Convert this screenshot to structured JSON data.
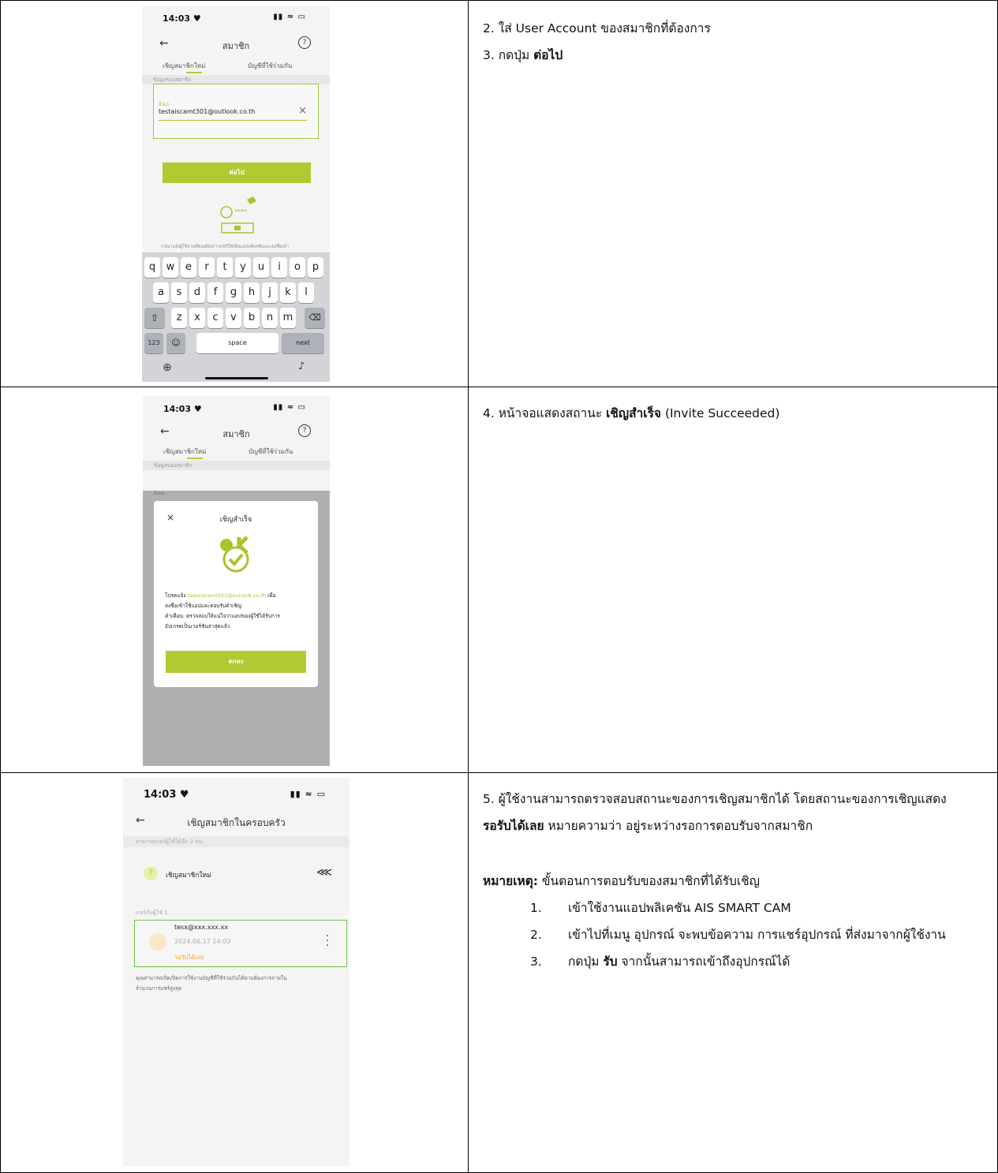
{
  "phone1": {
    "time": "14:03 ♥",
    "title": "สมาชิก",
    "tab_new": "เชิญสมาชิกใหม่",
    "tab_shared": "บัญชีที่ใช้ร่วมกัน",
    "section": "ข้อมูลของสมาชิก",
    "field_label": "อีเมล",
    "field_value": "testaiscamt301@outlook.co.th",
    "next_button": "ต่อไป",
    "hint": "กรุณาแจ้งผู้ใช้งานที่คุณต้องการแชร์ให้เปิดแอปพลิเคชันและลงชื่อเข้า",
    "keyboard_rows": [
      [
        "q",
        "w",
        "e",
        "r",
        "t",
        "y",
        "u",
        "i",
        "o",
        "p"
      ],
      [
        "a",
        "s",
        "d",
        "f",
        "g",
        "h",
        "j",
        "k",
        "l"
      ],
      [
        "z",
        "x",
        "c",
        "v",
        "b",
        "n",
        "m"
      ]
    ],
    "key_123": "123",
    "key_space": "space",
    "key_next": "next"
  },
  "phone2": {
    "time": "14:03 ♥",
    "title": "สมาชิก",
    "tab_new": "เชิญสมาชิกใหม่",
    "tab_shared": "บัญชีที่ใช้ร่วมกัน",
    "section": "ข้อมูลของสมาชิก",
    "field_label": "อีเมล",
    "modal_title": "เชิญสำเร็จ",
    "msg_prefix": "โปรดแจ้ง ",
    "msg_email": "testaiscamt301@outlook.co.th",
    "msg_suffix": " เพื่อ",
    "msg_line2": "ลงชื่อเข้าใช้แอปและตอบรับคำเชิญ",
    "msg_line3": "คำเตือน: ตรวจสอบให้แน่ใจว่าแอปของผู้ใช้ได้รับการ",
    "msg_line4": "อัปเกรดเป็นเวอร์ชันล่าสุดแล้ว",
    "ok_button": "ตกลง"
  },
  "phone3": {
    "time": "14:03 ♥",
    "title": "เชิญสมาชิกในครอบครัว",
    "sub1": "สามารถแชร์ผู้ใช้ได้อีก 2 คน",
    "invite_new": "เชิญสมาชิกใหม่",
    "sub2": "แชร์กับผู้ใช้ 1",
    "member_email": "tesx@xxx.xxx.xx",
    "member_date": "2024.06.17 14:03",
    "member_status": "รอรับได้เลย",
    "footer1": "คุณสามารถเปิด/ปิดการใช้งานบัญชีที่ใช้ร่วมกันได้ตามต้องการภายใน",
    "footer2": "จำนวนการแชร์สูงสุด"
  },
  "row1": {
    "line1": "2. ใส่ User Account ของสมาชิกที่ต้องการ",
    "line2_prefix": "3. กดปุ่ม ",
    "line2_bold": "ต่อไป"
  },
  "row2": {
    "prefix": "4. หน้าจอแสดงสถานะ ",
    "bold": "เชิญสำเร็จ",
    "suffix": " (Invite Succeeded)"
  },
  "row3": {
    "para1": "5. ผู้ใช้งานสามารถตรวจสอบสถานะของการเชิญสมาชิกได้ โดยสถานะของการเชิญแสดง",
    "para2_bold": "รอรับได้เลย",
    "para2_rest": "  หมายความว่า อยู่ระหว่างรอการตอบรับจากสมาชิก",
    "note_label": "หมายเหตุ:",
    "note_rest": " ขั้นตอนการตอบรับของสมาชิกที่ได้รับเชิญ",
    "items": [
      {
        "num": "1.",
        "text": "เข้าใช้งานแอปพลิเคชัน AIS SMART CAM"
      },
      {
        "num": "2.",
        "text": "เข้าไปที่เมนู อุปกรณ์ จะพบข้อความ การแชร์อุปกรณ์ ที่ส่งมาจากผู้ใช้งาน"
      }
    ],
    "item3_num": "3.",
    "item3_prefix": "กดปุ่ม ",
    "item3_bold": "รับ",
    "item3_rest": " จากนั้นสามารถเข้าถึงอุปกรณ์ได้"
  }
}
